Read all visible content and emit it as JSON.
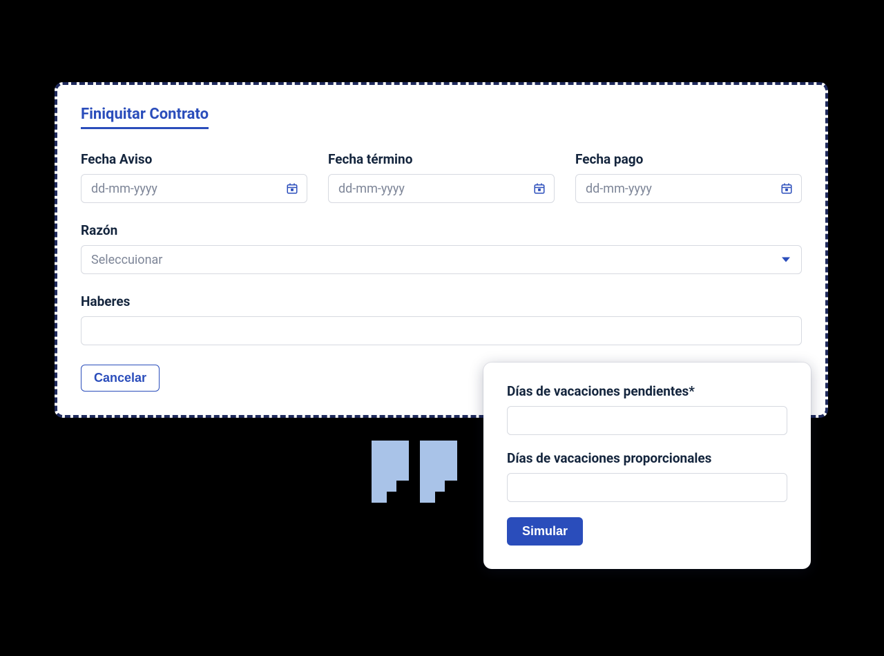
{
  "card": {
    "title": "Finiquitar Contrato",
    "dates": {
      "aviso": {
        "label": "Fecha Aviso",
        "placeholder": "dd-mm-yyyy"
      },
      "termino": {
        "label": "Fecha término",
        "placeholder": "dd-mm-yyyy"
      },
      "pago": {
        "label": "Fecha pago",
        "placeholder": "dd-mm-yyyy"
      }
    },
    "razon": {
      "label": "Razón",
      "placeholder": "Seleccuionar"
    },
    "haberes": {
      "label": "Haberes"
    },
    "cancel_label": "Cancelar"
  },
  "popup": {
    "pendientes_label": "Días de vacaciones pendientes*",
    "proporcionales_label": "Días de vacaciones proporcionales",
    "simulate_label": "Simular"
  }
}
